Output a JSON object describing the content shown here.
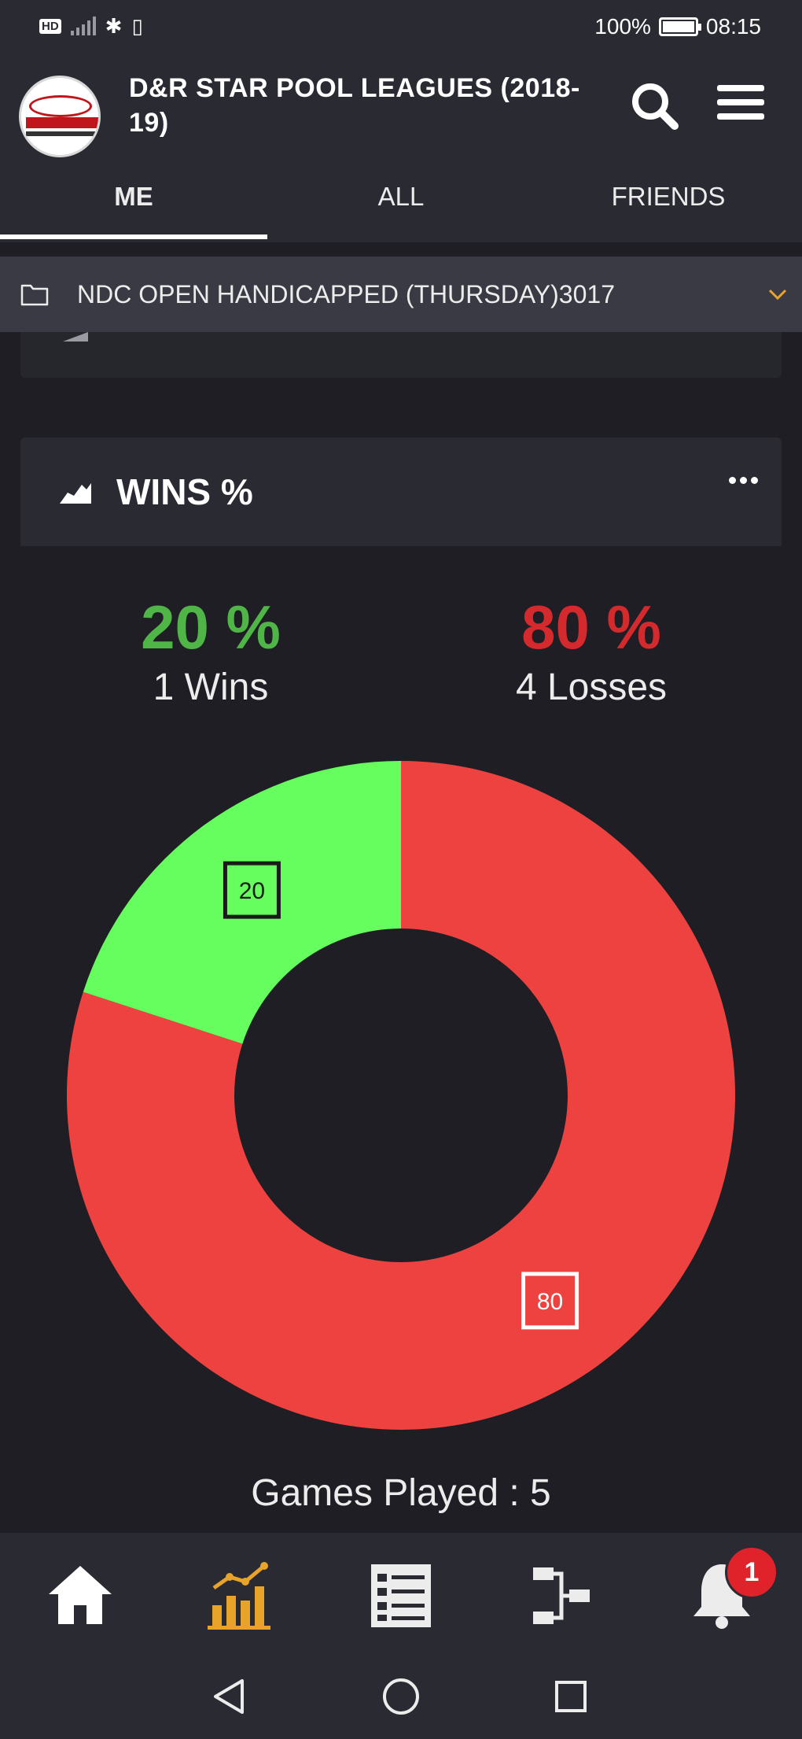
{
  "status_bar": {
    "hd": "HD",
    "battery": "100%",
    "time": "08:15"
  },
  "header": {
    "title": "D&R STAR POOL LEAGUES (2018-19)",
    "logo_icon": "dr-star-amusements-logo"
  },
  "tabs": [
    {
      "label": "ME",
      "active": true
    },
    {
      "label": "ALL",
      "active": false
    },
    {
      "label": "FRIENDS",
      "active": false
    }
  ],
  "league_selector": {
    "label": "NDC OPEN HANDICAPPED (THURSDAY)3017",
    "accent": "#e8a32a"
  },
  "wins_card": {
    "title": "WINS %",
    "wins": {
      "pct": "20 %",
      "label": "1 Wins",
      "color": "#4fb547"
    },
    "losses": {
      "pct": "80 %",
      "label": "4 Losses",
      "color": "#d42a2e"
    },
    "games_played": "Games Played : 5"
  },
  "chart_data": {
    "type": "pie",
    "donut": true,
    "categories": [
      "Wins",
      "Losses"
    ],
    "values": [
      20,
      80
    ],
    "data_labels": [
      "20",
      "80"
    ],
    "colors": [
      "#66fd5e",
      "#ee4240"
    ]
  },
  "bottom_nav": {
    "items": [
      "home-icon",
      "stats-chart-icon",
      "list-icon",
      "bracket-icon",
      "bell-icon"
    ],
    "active": "stats-chart-icon",
    "active_color": "#e8a32a",
    "notification_count": "1"
  }
}
